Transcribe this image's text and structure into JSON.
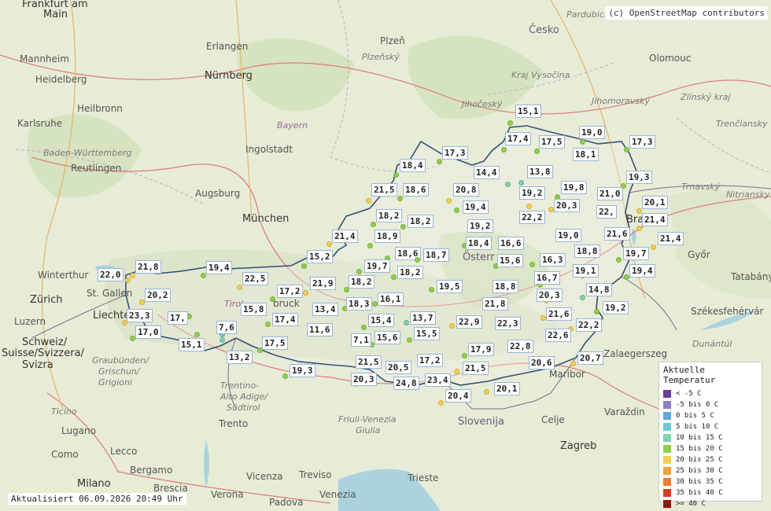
{
  "attribution": "(c) OpenStreetMap contributors",
  "updated": "Aktualisiert 06.09.2026 20:49 Uhr",
  "legend": {
    "title": "Aktuelle Temperatur",
    "items": [
      {
        "label": "< -5 C",
        "color": "#6a3d9a"
      },
      {
        "label": "-5 bis 0 C",
        "color": "#8c7fc0"
      },
      {
        "label": "0 bis 5 C",
        "color": "#5fa8dc"
      },
      {
        "label": "5 bis 10 C",
        "color": "#6cc9d2"
      },
      {
        "label": "10 bis 15 C",
        "color": "#7dd3b0"
      },
      {
        "label": "15 bis 20 C",
        "color": "#8fcf4a"
      },
      {
        "label": "20 bis 25 C",
        "color": "#f5cf4d"
      },
      {
        "label": "25 bis 30 C",
        "color": "#f3a13b"
      },
      {
        "label": "30 bis 35 C",
        "color": "#ee7a30"
      },
      {
        "label": "35 bis 40 C",
        "color": "#d93a23"
      },
      {
        "label": ">= 40 C",
        "color": "#8a1a12"
      }
    ]
  },
  "places": {
    "frankfurt": "Frankfurt am",
    "main": "Main",
    "mannheim": "Mannheim",
    "heidelberg": "Heidelberg",
    "heilbronn": "Heilbronn",
    "karlsruhe": "Karlsruhe",
    "bw": "Baden-Württemberg",
    "reutlingen": "Reutlingen",
    "nuernberg": "Nürnberg",
    "erlangen": "Erlangen",
    "bayern": "Bayern",
    "ingolstadt": "Ingolstadt",
    "augsburg": "Augsburg",
    "muenchen": "München",
    "winterthur": "Winterthur",
    "stgallen": "St. Gallen",
    "zuerich": "Zürich",
    "luzern": "Luzern",
    "schweiz": "Schweiz/",
    "suisse": "Suisse/Svizzera/",
    "svizra": "Svizra",
    "liechtenstein": "Liechte",
    "tirol": "Tirol",
    "innsbruck": "bruck",
    "graubuenden": "Graubünden/",
    "grischun": "Grischun/",
    "grigioni": "Grigioni",
    "ticino": "Ticino",
    "lugano": "Lugano",
    "como": "Como",
    "lecco": "Lecco",
    "bergamo": "Bergamo",
    "milano": "Milano",
    "brescia": "Brescia",
    "trento": "Trento",
    "trentino": "Trentino-",
    "altoadige": "Alto Adige/",
    "suedtirol": "Südtirol",
    "verona": "Verona",
    "vicenza": "Vicenza",
    "padova": "Padova",
    "venezia": "Venezia",
    "treviso": "Treviso",
    "friuli": "Friuli-Venezia",
    "giulia": "Giulia",
    "trieste": "Trieste",
    "slovenija": "Slovenija",
    "celje": "Celje",
    "maribor": "Maribor",
    "zagreb": "Zagreb",
    "varazdin": "Varaždin",
    "zalaegerszeg": "Zalaegerszeg",
    "dunantul": "Dunántúl",
    "szekesfehervar": "Székesfehérvár",
    "tatabanya": "Tatabánya",
    "gyor": "Győr",
    "bratislava": "Bra",
    "trnavsky": "Trnavský",
    "nitriansky": "Nitriansky",
    "trenciansky": "Trenčiansky",
    "zlinsky": "Zlínský kraj",
    "olomouc": "Olomouc",
    "jihomoravsky": "Jihomoravský",
    "vysocina": "Kraj Vysočina",
    "jihocesky": "Jihočeský",
    "cesko": "Česko",
    "plzen": "Plzeň",
    "plzensky": "Plzeňský",
    "pardubicky": "Pardubický",
    "osterreich": "Österr"
  },
  "stations": [
    {
      "v": "15,1",
      "c": "#8fcf4a"
    },
    {
      "v": "17,4",
      "c": "#8fcf4a"
    },
    {
      "v": "17,5",
      "c": "#8fcf4a"
    },
    {
      "v": "19,0",
      "c": "#8fcf4a"
    },
    {
      "v": "18,1",
      "c": "#8fcf4a"
    },
    {
      "v": "17,3",
      "c": "#8fcf4a"
    },
    {
      "v": "17,3",
      "c": "#8fcf4a"
    },
    {
      "v": "18,4",
      "c": "#8fcf4a"
    },
    {
      "v": "14,4",
      "c": "#7dd3b0"
    },
    {
      "v": "13,8",
      "c": "#7dd3b0"
    },
    {
      "v": "19,3",
      "c": "#8fcf4a"
    },
    {
      "v": "21,5",
      "c": "#f5cf4d"
    },
    {
      "v": "18,6",
      "c": "#8fcf4a"
    },
    {
      "v": "20,8",
      "c": "#f5cf4d"
    },
    {
      "v": "19,2",
      "c": "#8fcf4a"
    },
    {
      "v": "19,8",
      "c": "#8fcf4a"
    },
    {
      "v": "21,0",
      "c": "#f5cf4d"
    },
    {
      "v": "20,1",
      "c": "#f5cf4d"
    },
    {
      "v": "19,4",
      "c": "#8fcf4a"
    },
    {
      "v": "20,3",
      "c": "#f5cf4d"
    },
    {
      "v": "22,2",
      "c": "#f5cf4d"
    },
    {
      "v": "22,",
      "c": "#f5cf4d"
    },
    {
      "v": "21,4",
      "c": "#f5cf4d"
    },
    {
      "v": "18,2",
      "c": "#8fcf4a"
    },
    {
      "v": "18,2",
      "c": "#8fcf4a"
    },
    {
      "v": "19,2",
      "c": "#8fcf4a"
    },
    {
      "v": "21,6",
      "c": "#f5cf4d"
    },
    {
      "v": "21,4",
      "c": "#f5cf4d"
    },
    {
      "v": "21,4",
      "c": "#f5cf4d"
    },
    {
      "v": "18,9",
      "c": "#8fcf4a"
    },
    {
      "v": "19,0",
      "c": "#8fcf4a"
    },
    {
      "v": "18,6",
      "c": "#8fcf4a"
    },
    {
      "v": "18,7",
      "c": "#8fcf4a"
    },
    {
      "v": "18,4",
      "c": "#8fcf4a"
    },
    {
      "v": "16,6",
      "c": "#8fcf4a"
    },
    {
      "v": "18,8",
      "c": "#8fcf4a"
    },
    {
      "v": "19,7",
      "c": "#8fcf4a"
    },
    {
      "v": "15,2",
      "c": "#8fcf4a"
    },
    {
      "v": "19,7",
      "c": "#8fcf4a"
    },
    {
      "v": "15,6",
      "c": "#8fcf4a"
    },
    {
      "v": "16,3",
      "c": "#8fcf4a"
    },
    {
      "v": "19,4",
      "c": "#8fcf4a"
    },
    {
      "v": "21,8",
      "c": "#f5cf4d"
    },
    {
      "v": "19,4",
      "c": "#8fcf4a"
    },
    {
      "v": "18,2",
      "c": "#8fcf4a"
    },
    {
      "v": "19,1",
      "c": "#8fcf4a"
    },
    {
      "v": "22,0",
      "c": "#f5cf4d"
    },
    {
      "v": "22,5",
      "c": "#f5cf4d"
    },
    {
      "v": "21,9",
      "c": "#f5cf4d"
    },
    {
      "v": "18,2",
      "c": "#8fcf4a"
    },
    {
      "v": "19,5",
      "c": "#8fcf4a"
    },
    {
      "v": "18,8",
      "c": "#8fcf4a"
    },
    {
      "v": "16,7",
      "c": "#8fcf4a"
    },
    {
      "v": "14,8",
      "c": "#7dd3b0"
    },
    {
      "v": "20,2",
      "c": "#f5cf4d"
    },
    {
      "v": "17,2",
      "c": "#8fcf4a"
    },
    {
      "v": "16,1",
      "c": "#8fcf4a"
    },
    {
      "v": "20,3",
      "c": "#f5cf4d"
    },
    {
      "v": "19,2",
      "c": "#8fcf4a"
    },
    {
      "v": "23,3",
      "c": "#f5cf4d"
    },
    {
      "v": "15,8",
      "c": "#8fcf4a"
    },
    {
      "v": "18,3",
      "c": "#8fcf4a"
    },
    {
      "v": "21,8",
      "c": "#f5cf4d"
    },
    {
      "v": "21,6",
      "c": "#f5cf4d"
    },
    {
      "v": "17,",
      "c": "#8fcf4a"
    },
    {
      "v": "17,4",
      "c": "#8fcf4a"
    },
    {
      "v": "13,4",
      "c": "#7dd3b0"
    },
    {
      "v": "15,4",
      "c": "#8fcf4a"
    },
    {
      "v": "13,7",
      "c": "#7dd3b0"
    },
    {
      "v": "22,9",
      "c": "#f5cf4d"
    },
    {
      "v": "22,3",
      "c": "#f5cf4d"
    },
    {
      "v": "22,2",
      "c": "#f5cf4d"
    },
    {
      "v": "17,0",
      "c": "#8fcf4a"
    },
    {
      "v": "7,6",
      "c": "#6cc9d2"
    },
    {
      "v": "11,6",
      "c": "#7dd3b0"
    },
    {
      "v": "15,6",
      "c": "#8fcf4a"
    },
    {
      "v": "15,5",
      "c": "#8fcf4a"
    },
    {
      "v": "22,6",
      "c": "#f5cf4d"
    },
    {
      "v": "15,1",
      "c": "#8fcf4a"
    },
    {
      "v": "17,5",
      "c": "#8fcf4a"
    },
    {
      "v": "7,1",
      "c": "#6cc9d2"
    },
    {
      "v": "17,9",
      "c": "#8fcf4a"
    },
    {
      "v": "22,8",
      "c": "#f5cf4d"
    },
    {
      "v": "20,7",
      "c": "#f5cf4d"
    },
    {
      "v": "13,2",
      "c": "#7dd3b0"
    },
    {
      "v": "21,5",
      "c": "#f5cf4d"
    },
    {
      "v": "20,5",
      "c": "#f5cf4d"
    },
    {
      "v": "17,2",
      "c": "#8fcf4a"
    },
    {
      "v": "21,5",
      "c": "#f5cf4d"
    },
    {
      "v": "20,6",
      "c": "#f5cf4d"
    },
    {
      "v": "19,3",
      "c": "#8fcf4a"
    },
    {
      "v": "20,3",
      "c": "#f5cf4d"
    },
    {
      "v": "24,8",
      "c": "#f5cf4d"
    },
    {
      "v": "23,4",
      "c": "#f5cf4d"
    },
    {
      "v": "20,1",
      "c": "#f5cf4d"
    },
    {
      "v": "20,4",
      "c": "#f5cf4d"
    }
  ]
}
